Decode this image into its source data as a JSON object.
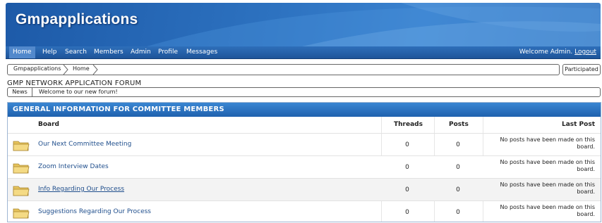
{
  "site": {
    "title": "Gmpapplications"
  },
  "nav": {
    "items": [
      "Home",
      "Help",
      "Search",
      "Members",
      "Admin",
      "Profile",
      "Messages"
    ],
    "welcome_text": "Welcome Admin.",
    "logout_label": "Logout"
  },
  "breadcrumb": {
    "items": [
      "Gmpapplications",
      "Home"
    ]
  },
  "participated_label": "Participated",
  "forum_name": "GMP NETWORK APPLICATION FORUM",
  "news": {
    "label": "News",
    "text": "Welcome to our new forum!"
  },
  "section": {
    "title": "GENERAL INFORMATION FOR COMMITTEE MEMBERS",
    "columns": {
      "board": "Board",
      "threads": "Threads",
      "posts": "Posts",
      "last_post": "Last Post"
    },
    "boards": [
      {
        "name": "Our Next Committee Meeting",
        "threads": "0",
        "posts": "0",
        "last_post": "No posts have been made on this board."
      },
      {
        "name": "Zoom Interview Dates",
        "threads": "0",
        "posts": "0",
        "last_post": "No posts have been made on this board."
      },
      {
        "name": "Info Regarding Our Process",
        "threads": "0",
        "posts": "0",
        "last_post": "No posts have been made on this board."
      },
      {
        "name": "Suggestions Regarding Our Process",
        "threads": "0",
        "posts": "0",
        "last_post": "No posts have been made on this board."
      }
    ]
  },
  "icons": {
    "board": "folder-icon",
    "breadcrumb_separator": "chevron-right-icon"
  },
  "colors": {
    "header_blue": "#1f61ae",
    "link": "#1f4e8c"
  }
}
